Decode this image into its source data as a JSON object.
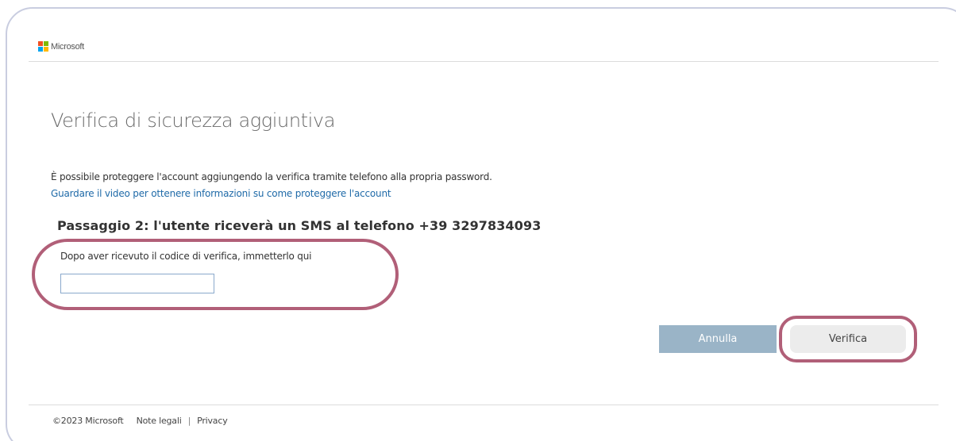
{
  "brand": {
    "name": "Microsoft",
    "logo_colors": [
      "#f25022",
      "#7fba00",
      "#00a4ef",
      "#ffb900"
    ]
  },
  "page": {
    "title": "Verifica di sicurezza aggiuntiva",
    "intro": "È possibile proteggere l'account aggiungendo la verifica tramite telefono alla propria password.",
    "video_link": "Guardare il video per ottenere informazioni su come proteggere l'account"
  },
  "step": {
    "title": "Passaggio 2: l'utente riceverà un SMS al telefono +39 3297834093",
    "code_label": "Dopo aver ricevuto il codice di verifica, immetterlo qui",
    "code_value": ""
  },
  "actions": {
    "cancel_label": "Annulla",
    "verify_label": "Verifica"
  },
  "footer": {
    "copyright": "©2023 Microsoft",
    "legal_link": "Note legali",
    "separator": "|",
    "privacy_link": "Privacy"
  },
  "colors": {
    "highlight": "#b15f78",
    "link": "#1f6aa8",
    "cancel_button": "#9ab4c7"
  }
}
